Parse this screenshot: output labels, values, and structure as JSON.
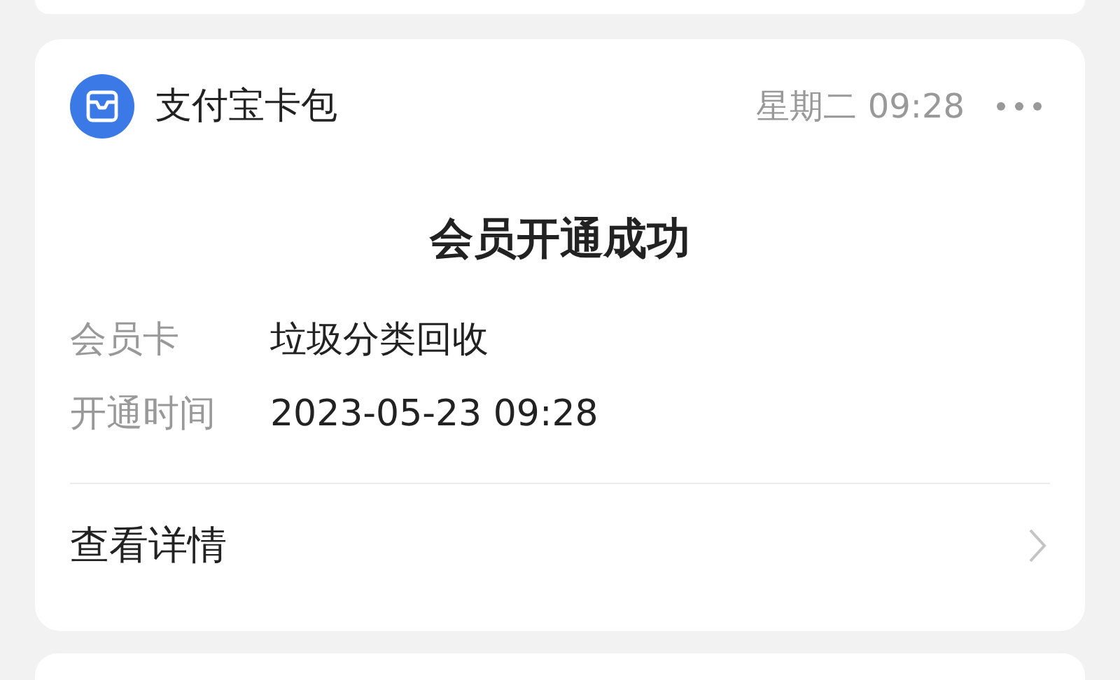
{
  "message_card": {
    "app_name": "支付宝卡包",
    "time": "星期二 09:28",
    "title": "会员开通成功",
    "fields": [
      {
        "label": "会员卡",
        "value": "垃圾分类回收"
      },
      {
        "label": "开通时间",
        "value": "2023-05-23 09:28"
      }
    ],
    "link": "查看详情"
  }
}
